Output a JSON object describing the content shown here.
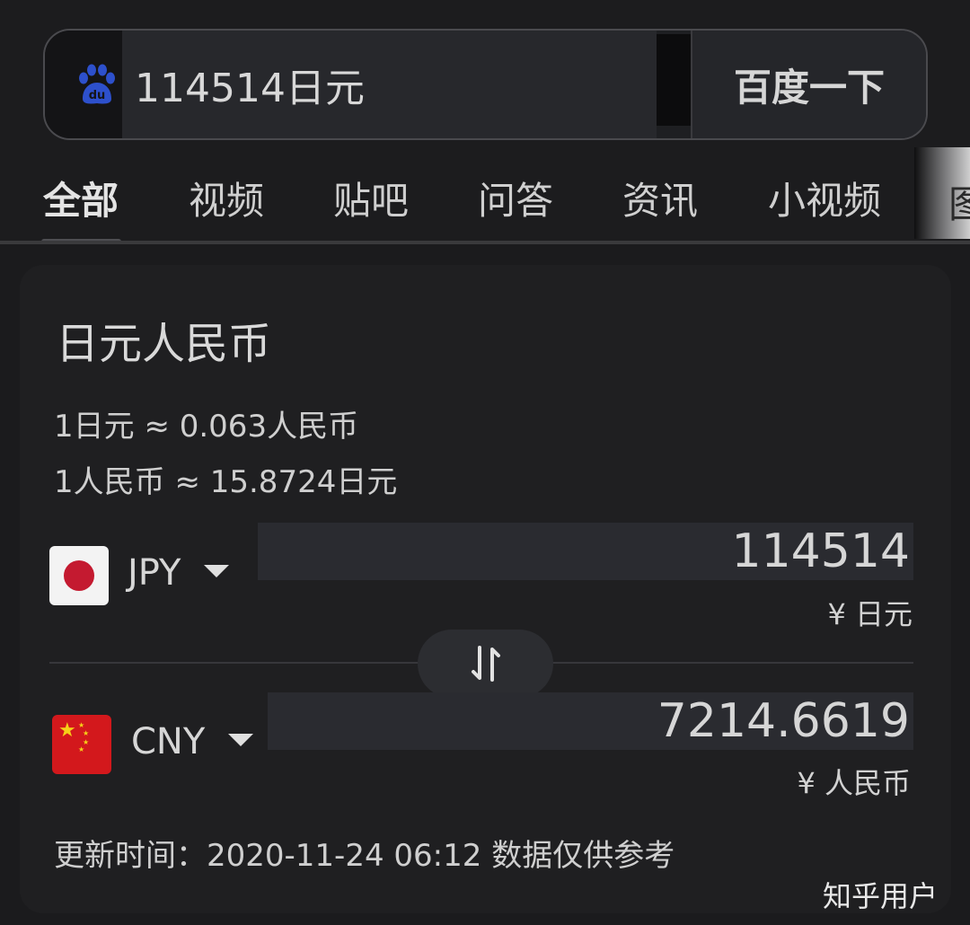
{
  "search": {
    "query": "114514日元",
    "button_label": "百度一下",
    "logo_icon": "baidu-paw-icon"
  },
  "tabs": [
    {
      "label": "全部",
      "active": true
    },
    {
      "label": "视频",
      "active": false
    },
    {
      "label": "贴吧",
      "active": false
    },
    {
      "label": "问答",
      "active": false
    },
    {
      "label": "资讯",
      "active": false
    },
    {
      "label": "小视频",
      "active": false
    },
    {
      "label": "图",
      "active": false
    }
  ],
  "converter": {
    "title": "日元人民币",
    "rate_1": "1日元 ≈ 0.063人民币",
    "rate_2": "1人民币 ≈ 15.8724日元",
    "from": {
      "code": "JPY",
      "amount": "114514",
      "unit": "¥ 日元"
    },
    "to": {
      "code": "CNY",
      "amount": "7214.6619",
      "unit": "¥ 人民币"
    },
    "swap_icon": "swap-arrows-icon",
    "update_text": "更新时间：2020-11-24 06:12 数据仅供参考"
  },
  "watermark": "知乎用户",
  "colors": {
    "background": "#1b1b1d",
    "card": "#1f1f21",
    "baidu_blue": "#2d50cc",
    "jp_red": "#c41a30",
    "cn_red": "#d3181c",
    "cn_yellow": "#f6d118"
  }
}
